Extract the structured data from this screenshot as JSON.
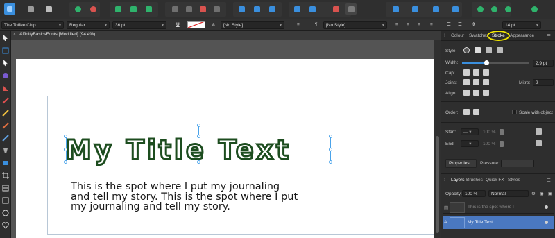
{
  "toolbar": {
    "icons": [
      "affinity-publisher-logo",
      "persona-grid-icon",
      "persona-export-icon",
      "snapping-icon",
      "snapping-settings-icon",
      "transform-icon",
      "align-icon",
      "insert-frame-icon",
      "boolean-icon",
      "arrange-icon",
      "distribute-icon",
      "table-icon",
      "mirror-icon",
      "pin-icon",
      "flip-icon",
      "group-icon",
      "ungroup-icon",
      "preflight-icon",
      "link-icon",
      "object-icon",
      "comment-icon",
      "account-icon"
    ],
    "colors": {
      "blue": "#3a8fde",
      "green": "#2fb36c",
      "red": "#d9534f"
    }
  },
  "context": {
    "font": "The Toffee Chip",
    "style": "Regular",
    "size": "36 pt",
    "underline": "U",
    "paragraph_style_icon": "a",
    "character_style": "[No Style]",
    "paragraph_mark": "¶",
    "paragraph_style": "[No Style]",
    "leading_size": "14 pt"
  },
  "doc": {
    "close": "×",
    "tab_title": "AffinityBasicsFonts [Modified] (94.4%)"
  },
  "canvas": {
    "title_text": "My Title Text",
    "body_text": "This is the spot where I put my journaling and tell my story. This is the spot where I put my journaling and tell my story."
  },
  "panel": {
    "tabs": [
      "Colour",
      "Swatches",
      "Stroke",
      "Appearance"
    ],
    "active_tab": "Stroke",
    "style_label": "Style:",
    "width_label": "Width:",
    "width_value": "2.9 pt",
    "width_fraction": 0.36,
    "cap_label": "Cap:",
    "joins_label": "Joins:",
    "mitre_label": "Mitre:",
    "mitre_value": "2",
    "align_label": "Align:",
    "order_label": "Order:",
    "scale_label": "Scale with object",
    "start_label": "Start:",
    "end_label": "End:",
    "start_pct": "100 %",
    "end_pct": "100 %",
    "properties_button": "Properties...",
    "pressure_label": "Pressure:"
  },
  "layers": {
    "tabs": [
      "Layers",
      "Brushes",
      "Quick FX",
      "Styles"
    ],
    "opacity_label": "Opacity:",
    "opacity_value": "100 %",
    "blend_mode": "Normal",
    "rows": [
      {
        "name": "This is the spot where I",
        "selected": false
      },
      {
        "name": "My Title Text",
        "selected": true
      }
    ]
  }
}
